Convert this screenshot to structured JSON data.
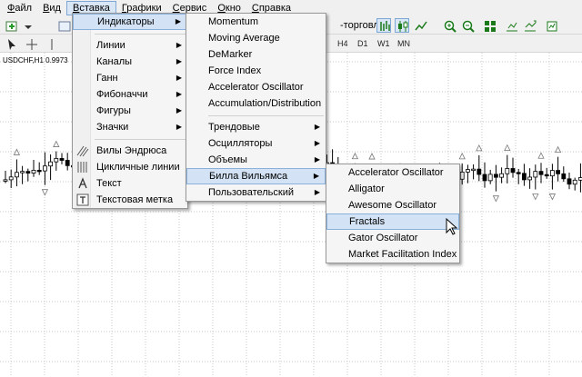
{
  "menubar": {
    "items": [
      {
        "label": "Файл",
        "mnemonic": "Ф",
        "rest": "айл"
      },
      {
        "label": "Вид",
        "mnemonic": "В",
        "rest": "ид"
      },
      {
        "label": "Вставка",
        "mnemonic": "В",
        "rest": "ставка"
      },
      {
        "label": "Графики",
        "mnemonic": "Г",
        "rest": "рафики"
      },
      {
        "label": "Сервис",
        "mnemonic": "С",
        "rest": "ервис"
      },
      {
        "label": "Окно",
        "mnemonic": "О",
        "rest": "кно"
      },
      {
        "label": "Справка",
        "mnemonic": "С",
        "rest": "правка"
      }
    ]
  },
  "toolbar": {
    "autotrade_label": "-торговля",
    "timeframes": [
      "H4",
      "D1",
      "W1",
      "MN"
    ]
  },
  "chart": {
    "symbol_label": "USDCHF,H1  0.9973"
  },
  "insert_menu": {
    "items": [
      {
        "label": "Индикаторы",
        "submenu": true,
        "selected": true
      },
      {
        "sep": true
      },
      {
        "label": "Линии",
        "submenu": true
      },
      {
        "label": "Каналы",
        "submenu": true
      },
      {
        "label": "Ганн",
        "submenu": true
      },
      {
        "label": "Фибоначчи",
        "submenu": true
      },
      {
        "label": "Фигуры",
        "submenu": true
      },
      {
        "label": "Значки",
        "submenu": true
      },
      {
        "sep": true
      },
      {
        "label": "Вилы Эндрюса",
        "icon": "pitchfork-icon"
      },
      {
        "label": "Цикличные линии",
        "icon": "cycle-lines-icon"
      },
      {
        "label": "Текст",
        "icon": "text-icon"
      },
      {
        "label": "Текстовая метка",
        "icon": "text-label-icon"
      }
    ]
  },
  "indicators_menu": {
    "items": [
      {
        "label": "Momentum"
      },
      {
        "label": "Moving Average"
      },
      {
        "label": "DeMarker"
      },
      {
        "label": "Force Index"
      },
      {
        "label": "Accelerator Oscillator"
      },
      {
        "label": "Accumulation/Distribution"
      },
      {
        "sep": true
      },
      {
        "label": "Трендовые",
        "submenu": true
      },
      {
        "label": "Осцилляторы",
        "submenu": true
      },
      {
        "label": "Объемы",
        "submenu": true
      },
      {
        "label": "Билла Вильямса",
        "submenu": true,
        "selected": true
      },
      {
        "label": "Пользовательский",
        "submenu": true
      }
    ]
  },
  "williams_menu": {
    "items": [
      {
        "label": "Accelerator Oscillator"
      },
      {
        "label": "Alligator"
      },
      {
        "label": "Awesome Oscillator"
      },
      {
        "label": "Fractals",
        "selected": true
      },
      {
        "label": "Gator Oscillator"
      },
      {
        "label": "Market Facilitation Index"
      }
    ]
  },
  "colors": {
    "highlight": "#d3e3f5",
    "highlight_border": "#8ab1dc",
    "grid": "#c8c8c8",
    "candle": "#000000"
  }
}
